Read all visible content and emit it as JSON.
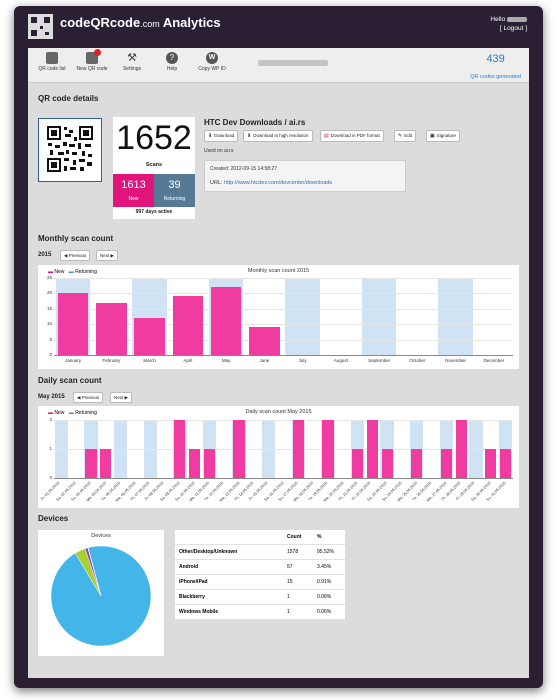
{
  "header": {
    "brand_main": "codeQRcode",
    "brand_domain": ".com",
    "brand_suffix": "Analytics",
    "hello": "Hello",
    "logout": "[ Logout ]"
  },
  "toolbar": {
    "items": [
      {
        "label": "QR code list",
        "icon": "grid-icon"
      },
      {
        "label": "New QR code",
        "icon": "new-qr-icon"
      },
      {
        "label": "Settings",
        "icon": "tools-icon"
      },
      {
        "label": "Help",
        "icon": "help-icon"
      },
      {
        "label": "Copy WP ID",
        "icon": "wordpress-icon"
      }
    ],
    "stat_value": "439",
    "stat_label": "QR codes generated"
  },
  "details": {
    "heading": "QR code details",
    "total": "1652",
    "scans_label": "Scans",
    "new_value": "1613",
    "new_label": "New",
    "returning_value": "39",
    "returning_label": "Returning",
    "active": "997 days active",
    "title": "HTC Dev Downloads / ai.rs",
    "buttons": [
      "Download",
      "Download in high resolution",
      "Download in PDF format",
      "Edit",
      "Signature"
    ],
    "used_on": "Used on ai.rs",
    "created": "Created: 2012-09-15 14:58:27",
    "url_label": "URL:",
    "url": "http://www.htcdev.com/devcenter/downloads"
  },
  "monthly": {
    "heading": "Monthly scan count",
    "year": "2015",
    "prev": "Previous",
    "next": "Next",
    "legend_new": "New",
    "legend_ret": "Returning"
  },
  "daily": {
    "heading": "Daily scan count",
    "period": "May 2015",
    "prev": "Previous",
    "next": "Next",
    "legend_new": "New",
    "legend_ret": "Returning"
  },
  "devices": {
    "heading": "Devices",
    "chart_title": "Devices",
    "col_count": "Count",
    "col_pct": "%",
    "rows": [
      {
        "name": "Other/Desktop/Unknown",
        "count": "1578",
        "pct": "95.52%"
      },
      {
        "name": "Android",
        "count": "57",
        "pct": "3.45%"
      },
      {
        "name": "iPhone/iPad",
        "count": "15",
        "pct": "0.91%"
      },
      {
        "name": "Blackberry",
        "count": "1",
        "pct": "0.06%"
      },
      {
        "name": "Windows Mobile",
        "count": "1",
        "pct": "0.06%"
      }
    ]
  },
  "colors": {
    "new": "#f03ca0",
    "returning": "#cfe3f5",
    "accent": "#2a7cc0"
  },
  "chart_data": [
    {
      "type": "bar",
      "title": "Monthly scan count 2015",
      "categories": [
        "January",
        "February",
        "March",
        "April",
        "May",
        "June",
        "July",
        "August",
        "September",
        "October",
        "November",
        "December"
      ],
      "series": [
        {
          "name": "New",
          "values": [
            20,
            17,
            12,
            19,
            22,
            9,
            0,
            0,
            0,
            0,
            0,
            0
          ]
        }
      ],
      "ylim": [
        0,
        25
      ],
      "yticks": [
        0,
        5,
        10,
        15,
        20,
        25
      ]
    },
    {
      "type": "bar",
      "title": "Daily scan count May 2015",
      "categories": [
        "Fr, 01.05.2015",
        "Sa, 02.05.2015",
        "Su, 03.05.2015",
        "Mo, 04.05.2015",
        "Tu, 05.05.2015",
        "We, 06.05.2015",
        "Th, 07.05.2015",
        "Fr, 08.05.2015",
        "Sa, 09.05.2015",
        "Su, 10.05.2015",
        "Mo, 11.05.2015",
        "Tu, 12.05.2015",
        "We, 13.05.2015",
        "Th, 14.05.2015",
        "Fr, 15.05.2015",
        "Sa, 16.05.2015",
        "Su, 17.05.2015",
        "Mo, 18.05.2015",
        "Tu, 19.05.2015",
        "We, 20.05.2015",
        "Th, 21.05.2015",
        "Fr, 22.05.2015",
        "Sa, 23.05.2015",
        "Su, 24.05.2015",
        "Mo, 25.05.2015",
        "Tu, 26.05.2015",
        "We, 27.05.2015",
        "Th, 28.05.2015",
        "Fr, 29.05.2015",
        "Sa, 30.05.2015",
        "Su, 31.05.2015"
      ],
      "series": [
        {
          "name": "New",
          "values": [
            0,
            0,
            1,
            1,
            0,
            0,
            0,
            0,
            2,
            1,
            1,
            0,
            2,
            0,
            0,
            0,
            2,
            0,
            2,
            0,
            1,
            2,
            1,
            0,
            1,
            0,
            1,
            2,
            0,
            1,
            1
          ]
        }
      ],
      "ylim": [
        0,
        2
      ],
      "yticks": [
        0,
        1,
        2
      ]
    },
    {
      "type": "pie",
      "title": "Devices",
      "categories": [
        "Other/Desktop/Unknown",
        "Android",
        "iPhone/iPad",
        "Blackberry",
        "Windows Mobile"
      ],
      "values": [
        1578,
        57,
        15,
        1,
        1
      ],
      "colors": [
        "#43b5e8",
        "#a8d032",
        "#8c3fb0",
        "#e05050",
        "#f0b030"
      ]
    }
  ]
}
